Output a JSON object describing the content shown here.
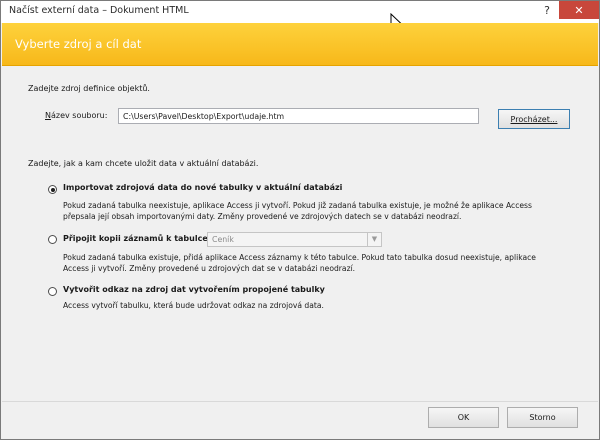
{
  "window": {
    "title": "Načíst externí data – Dokument HTML",
    "help_label": "?",
    "close_label": "✕"
  },
  "banner": {
    "title": "Vyberte zdroj a cíl dat"
  },
  "source": {
    "section_label": "Zadejte zdroj definice objektů.",
    "file_label_access": "N",
    "file_label_rest": "ázev souboru:",
    "file_value": "C:\\Users\\Pavel\\Desktop\\Export\\udaje.htm",
    "browse_label": "Procházet..."
  },
  "target": {
    "section_label": "Zadejte, jak a kam chcete uložit data v aktuální databázi.",
    "options": [
      {
        "label": "Importovat zdrojová data do nové tabulky v aktuální databázi",
        "access_key_index": 0,
        "checked": true,
        "description": "Pokud zadaná tabulka neexistuje, aplikace Access ji vytvoří. Pokud již zadaná tabulka existuje, je možné že aplikace Access přepsala její obsah importovanými daty. Změny provedené ve zdrojových datech se v databázi neodrazí."
      },
      {
        "label": "Připojit kopii záznamů k tabulce:",
        "checked": false,
        "select_value": "Ceník",
        "description": "Pokud zadaná tabulka existuje, přidá aplikace Access záznamy k této tabulce. Pokud tato tabulka dosud neexistuje, aplikace Access ji vytvoří. Změny provedené u zdrojových dat se v databázi neodrazí."
      },
      {
        "label": "Vytvořit odkaz na zdroj dat vytvořením propojené tabulky",
        "checked": false,
        "description": "Access vytvoří tabulku, která bude udržovat odkaz na zdrojová data."
      }
    ]
  },
  "footer": {
    "ok_label": "OK",
    "cancel_label": "Storno"
  },
  "colors": {
    "banner": "#fdc52c",
    "close": "#c8473b",
    "background": "#f0f0f0"
  }
}
